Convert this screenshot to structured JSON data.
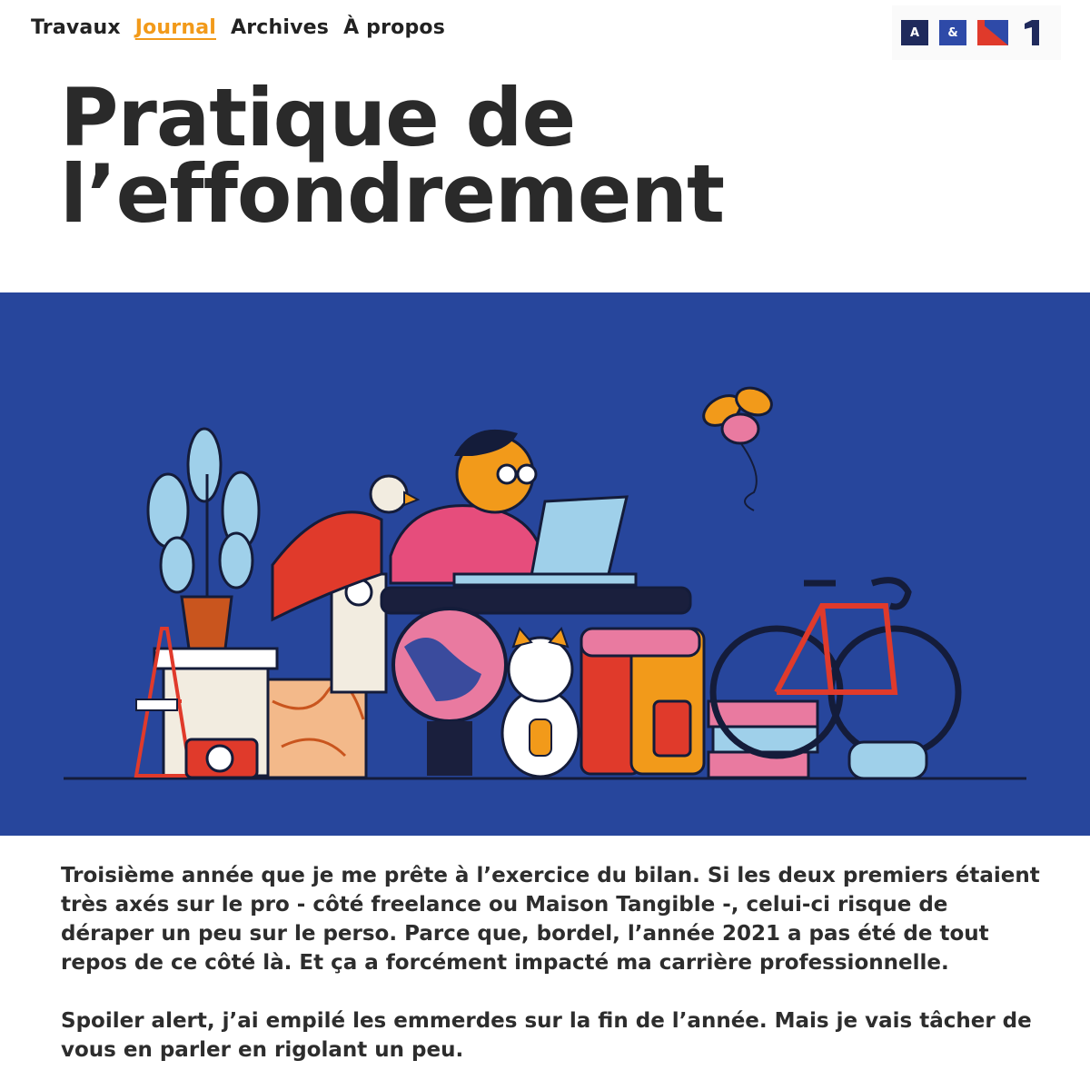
{
  "nav": {
    "items": [
      {
        "label": "Travaux",
        "active": false
      },
      {
        "label": "Journal",
        "active": true
      },
      {
        "label": "Archives",
        "active": false
      },
      {
        "label": "À propos",
        "active": false
      }
    ],
    "active_color": "#f29a1a"
  },
  "logo": {
    "tiles": [
      "A",
      "&"
    ],
    "colors": [
      "#1f2a5c",
      "#2e4aa8",
      "#e03a2b",
      "#1f2a5c"
    ]
  },
  "article": {
    "title_line1": "Pratique de",
    "title_line2": "l’effondrement",
    "paragraphs": [
      "Troisième année que je me prête à l’exercice du bilan. Si les deux premiers étaient très axés sur le pro - côté freelance ou Maison Tangible -, celui-ci risque de déraper un peu sur le perso. Parce que, bordel, l’année 2021 a pas été de tout repos de ce côté là. Et ça a forcément impacté ma carrière professionnelle.",
      "Spoiler alert, j’ai empilé les emmerdes sur la fin de l’année. Mais je vais tâcher de vous en parler en rigolant un peu."
    ]
  },
  "hero": {
    "background": "#27469c"
  }
}
